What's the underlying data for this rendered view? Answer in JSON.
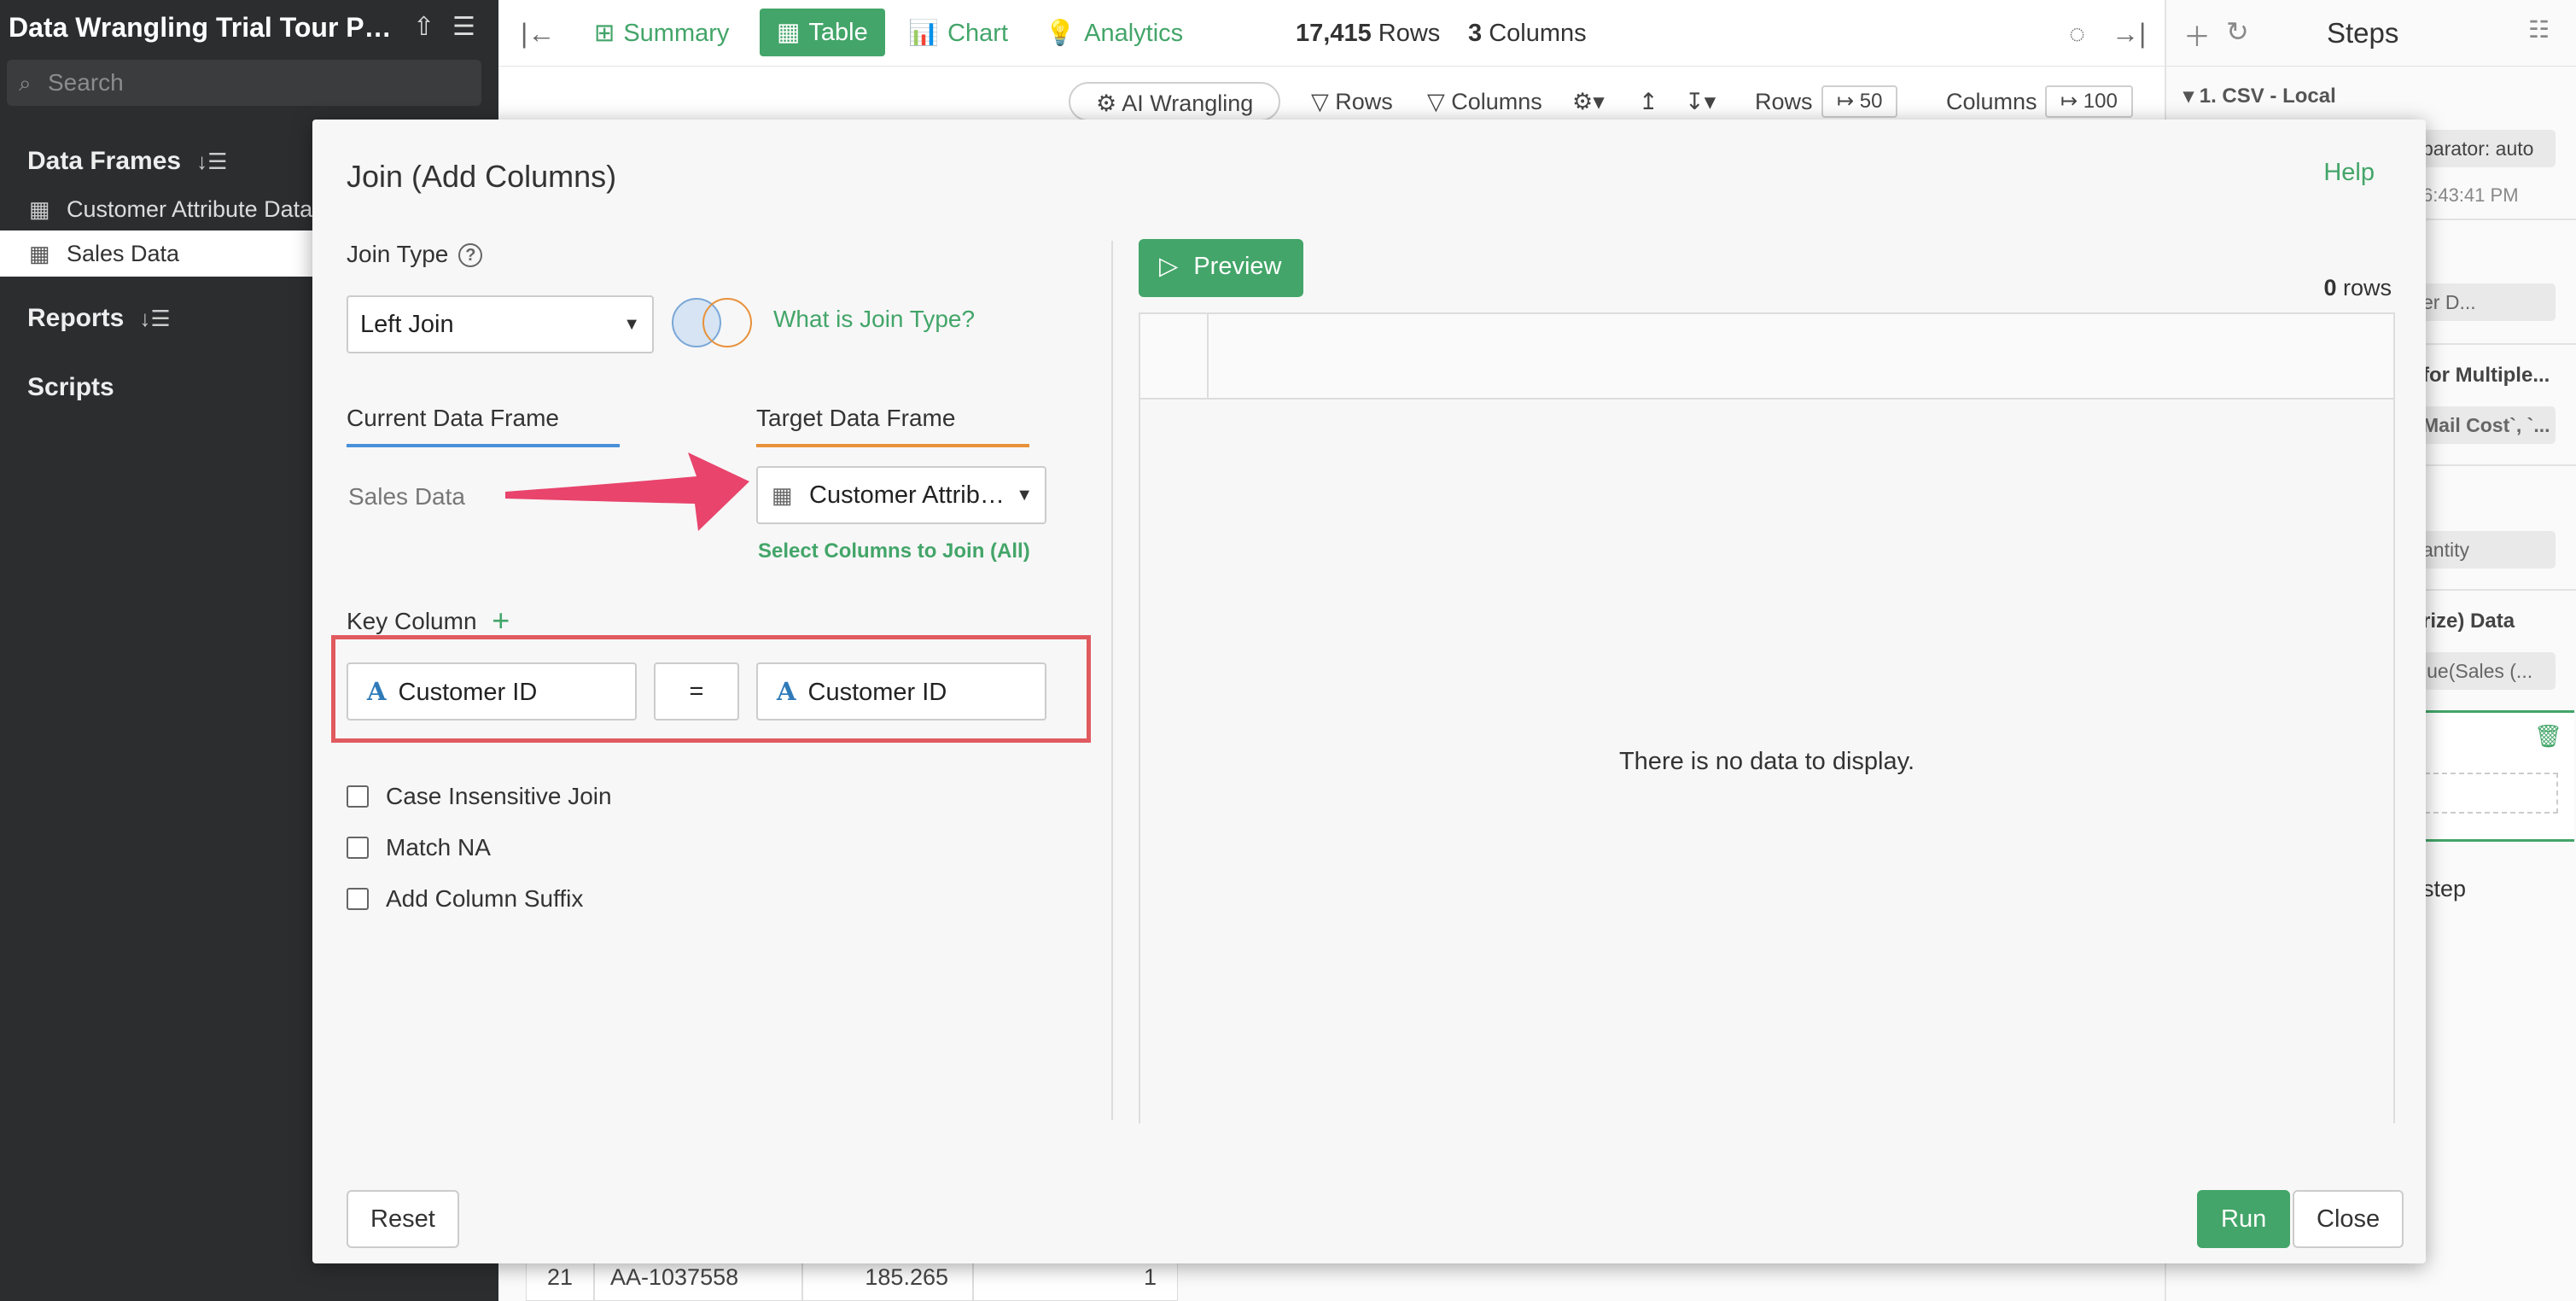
{
  "project": {
    "title": "Data Wrangling Trial Tour Pa...",
    "search_placeholder": "Search"
  },
  "sidebar": {
    "data_frames_label": "Data Frames",
    "items": [
      {
        "label": "Customer Attribute Data"
      },
      {
        "label": "Sales Data",
        "active": true
      }
    ],
    "reports_label": "Reports",
    "scripts_label": "Scripts"
  },
  "toolbar": {
    "summary": "Summary",
    "table": "Table",
    "chart": "Chart",
    "analytics": "Analytics",
    "rows_count": "17,415",
    "rows_label": "Rows",
    "cols_count": "3",
    "cols_label": "Columns"
  },
  "subbar": {
    "ai": "AI Wrangling",
    "rows_filter": "Rows",
    "cols_filter": "Columns",
    "rows_label": "Rows",
    "rows_value": "50",
    "cols_label": "Columns",
    "cols_value": "100"
  },
  "steps": {
    "title": "Steps",
    "step1": "1. CSV - Local",
    "separator": "parator: auto",
    "time": "6:43:41 PM",
    "chip1": "er D...",
    "multi": "for Multiple...",
    "chip2": "Mail Cost`, `...",
    "chip3": "antity",
    "summarize": "rize) Data",
    "chip4": "lue(Sales (...",
    "add_step": "step"
  },
  "bg_table": {
    "row_num": "21",
    "id": "AA-1037558",
    "value": "185.265",
    "qty": "1"
  },
  "dialog": {
    "title": "Join (Add Columns)",
    "help": "Help",
    "join_type_label": "Join Type",
    "join_type_value": "Left Join",
    "what_is_join": "What is Join Type?",
    "current_df_label": "Current Data Frame",
    "current_df_value": "Sales Data",
    "target_df_label": "Target Data Frame",
    "target_df_value": "Customer Attribut...",
    "select_cols": "Select Columns to Join (All)",
    "key_column_label": "Key Column",
    "key_left": "Customer ID",
    "equals": "=",
    "key_right": "Customer ID",
    "options": [
      "Case Insensitive Join",
      "Match NA",
      "Add Column Suffix"
    ],
    "preview": "Preview",
    "row_count": "0",
    "rows_word": "rows",
    "no_data": "There is no data to display.",
    "reset": "Reset",
    "run": "Run",
    "close": "Close"
  },
  "colors": {
    "accent": "#43a569",
    "highlight": "#e05a5f",
    "arrow": "#e8446c",
    "current_tab": "#4a90d9",
    "target_tab": "#e8913a"
  }
}
